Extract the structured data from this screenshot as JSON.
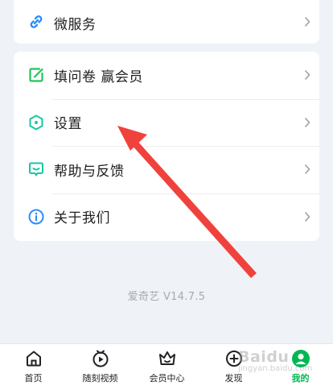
{
  "top_card": {
    "items": [
      {
        "label": "微服务",
        "icon": "link-icon",
        "color": "#2a8cff"
      }
    ]
  },
  "main_card": {
    "items": [
      {
        "label": "填问卷 赢会员",
        "icon": "edit-icon",
        "color": "#22c35d"
      },
      {
        "label": "设置",
        "icon": "hexagon-settings-icon",
        "color": "#16c8a0"
      },
      {
        "label": "帮助与反馈",
        "icon": "chat-bubble-icon",
        "color": "#16c8a0"
      },
      {
        "label": "关于我们",
        "icon": "info-icon",
        "color": "#2a8cff"
      }
    ]
  },
  "version": "爱奇艺 V14.7.5",
  "annotation": {
    "color": "#f0423c"
  },
  "watermark": {
    "text": "Baidu",
    "sub": "jingyan.baidu.com"
  },
  "tabbar": {
    "active_color": "#00b852",
    "tabs": [
      {
        "label": "首页",
        "icon": "home-icon"
      },
      {
        "label": "随刻视频",
        "icon": "video-icon"
      },
      {
        "label": "会员中心",
        "icon": "crown-icon"
      },
      {
        "label": "发现",
        "icon": "discover-plus-icon"
      },
      {
        "label": "我的",
        "icon": "profile-icon",
        "active": true
      }
    ]
  }
}
